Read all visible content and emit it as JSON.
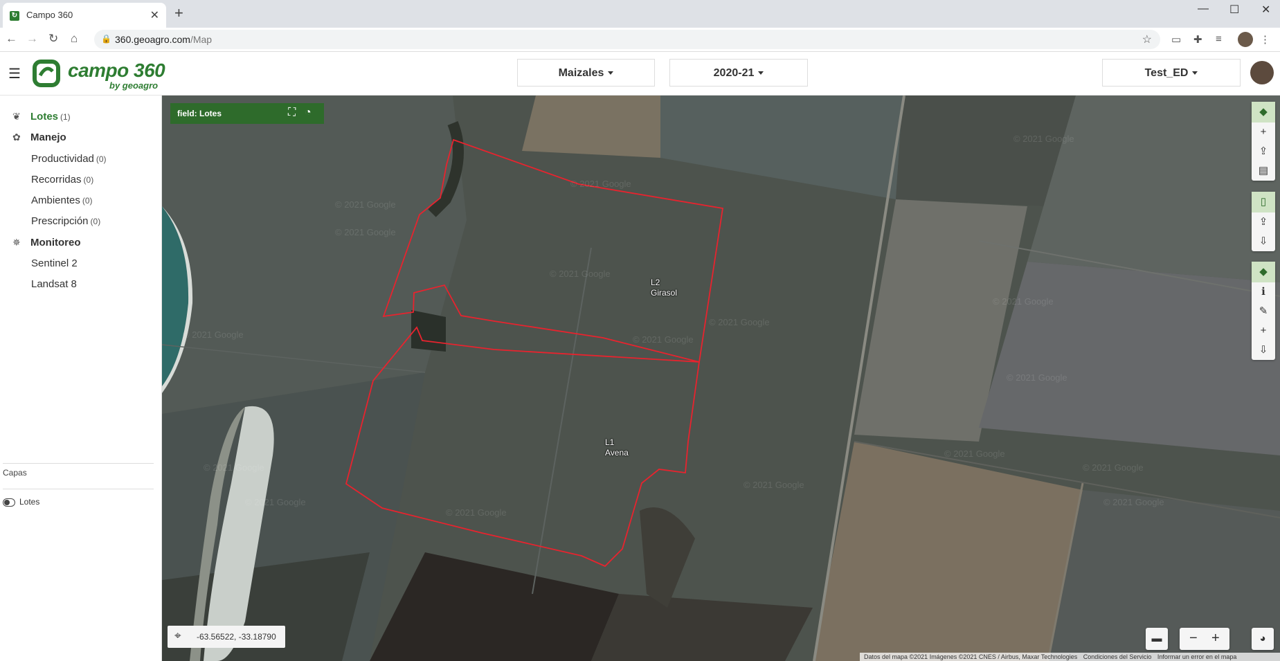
{
  "browser": {
    "tab_title": "Campo 360",
    "tab_close": "✕",
    "new_tab": "+",
    "url_host": "360.geoagro.com",
    "url_path": "/Map"
  },
  "header": {
    "logo_text": "campo 360",
    "logo_sub": "by geoagro",
    "dropdowns": [
      {
        "label": "Maizales"
      },
      {
        "label": "2020-21"
      },
      {
        "label": "Test_ED"
      }
    ]
  },
  "sidebar": {
    "items": [
      {
        "label": "Lotes",
        "count": "(1)",
        "icon": "sprout-icon",
        "active": true
      },
      {
        "label": "Manejo",
        "icon": "plant-hand-icon"
      },
      {
        "label": "Monitoreo",
        "icon": "satellite-icon"
      }
    ],
    "manejo_sub": [
      {
        "label": "Productividad",
        "count": "(0)"
      },
      {
        "label": "Recorridas",
        "count": "(0)"
      },
      {
        "label": "Ambientes",
        "count": "(0)"
      },
      {
        "label": "Prescripción",
        "count": "(0)"
      }
    ],
    "monitoreo_sub": [
      {
        "label": "Sentinel 2"
      },
      {
        "label": "Landsat 8"
      }
    ],
    "capas_title": "Capas",
    "layers": [
      {
        "label": "Lotes"
      }
    ]
  },
  "map": {
    "field_bar": "field: Lotes",
    "plots": [
      {
        "id": "L2",
        "crop": "Girasol"
      },
      {
        "id": "L1",
        "crop": "Avena"
      }
    ],
    "coords": "-63.56522, -33.18790",
    "watermark": "© 2021 Google",
    "attribution": {
      "data": "Datos del mapa ©2021 Imágenes ©2021 CNES / Airbus, Maxar Technologies",
      "terms": "Condiciones del Servicio",
      "report": "Informar un error en el mapa"
    },
    "colors": {
      "boundary": "#e8232e",
      "accent": "#2e6b2b"
    }
  }
}
